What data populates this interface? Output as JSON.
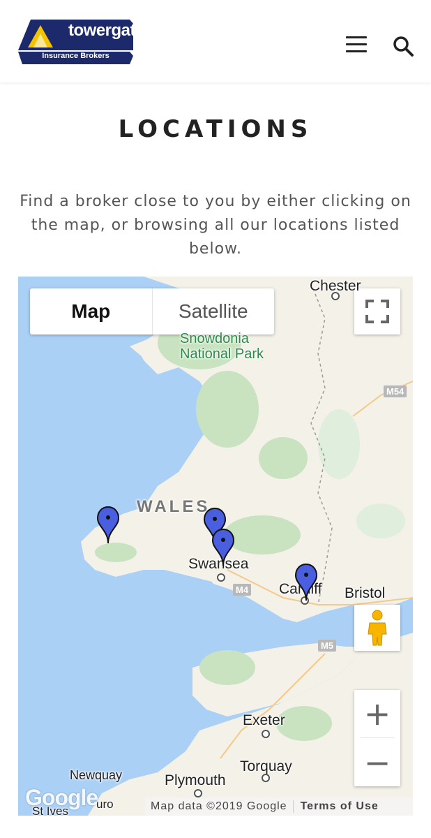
{
  "header": {
    "logo_name": "towergate",
    "logo_subtitle": "Insurance Brokers",
    "menu_icon": "hamburger-menu-icon",
    "search_icon": "search-icon"
  },
  "page": {
    "title": "LOCATIONS",
    "intro": "Find a broker close to you by either clicking on the map, or browsing all our locations listed below."
  },
  "map": {
    "type_controls": {
      "map_label": "Map",
      "satellite_label": "Satellite",
      "selected": "Map"
    },
    "labels": {
      "chester": "Chester",
      "snowdonia": "Snowdonia",
      "national_park": "National Park",
      "wales": "WALES",
      "swansea": "Swansea",
      "cardiff": "Cardiff",
      "bristol": "Bristol",
      "exeter": "Exeter",
      "torquay": "Torquay",
      "newquay": "Newquay",
      "plymouth": "Plymouth",
      "st_ives": "St Ives",
      "truro": "uro"
    },
    "roads": {
      "m54": "M54",
      "m4": "M4",
      "m5": "M5"
    },
    "markers_count": 4,
    "attribution": "Map data ©2019 Google",
    "terms": "Terms of Use",
    "google_logo": "Google",
    "colors": {
      "water": "#abd0f6",
      "land": "#f4f1e8",
      "park": "#c9e3c1",
      "marker": "#4a5ee0"
    }
  }
}
